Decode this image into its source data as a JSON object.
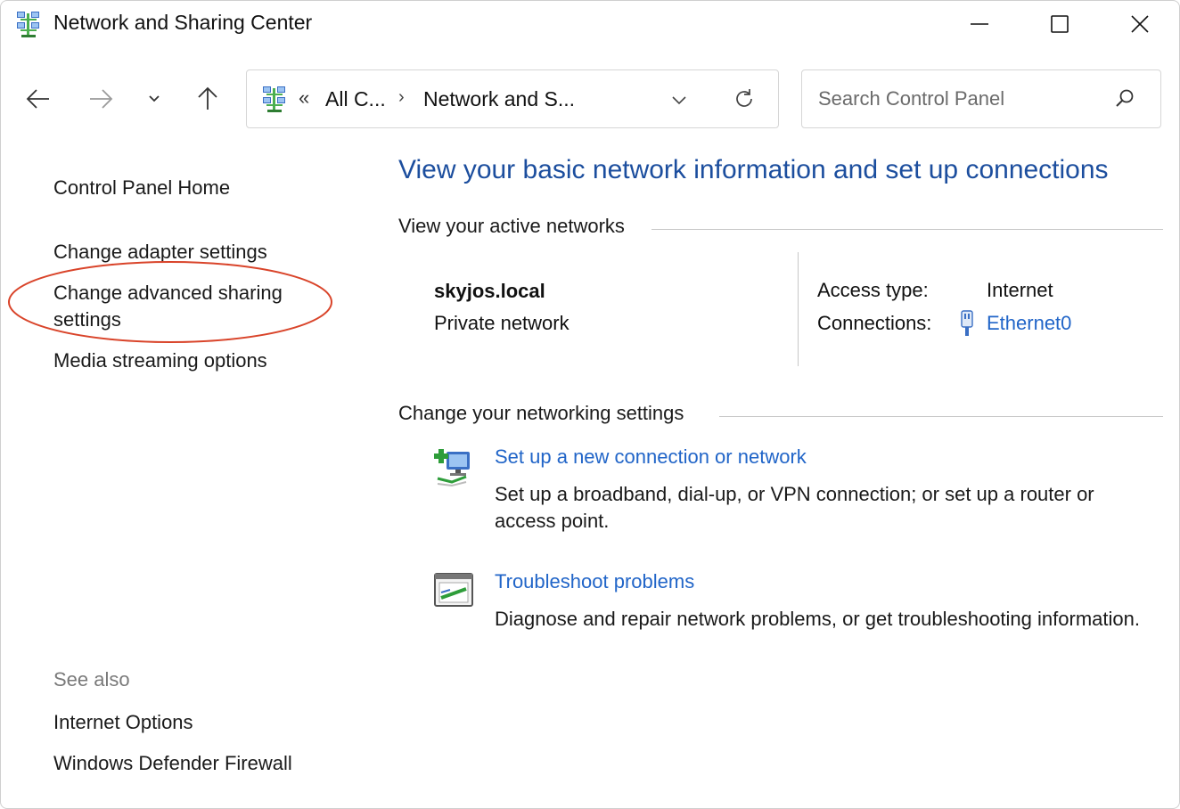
{
  "window": {
    "title": "Network and Sharing Center"
  },
  "address_bar": {
    "overflow_glyph": "«",
    "crumbs": [
      "All C...",
      "Network and S..."
    ],
    "separator": "›"
  },
  "search": {
    "placeholder": "Search Control Panel",
    "value": ""
  },
  "sidebar": {
    "home": "Control Panel Home",
    "items": [
      "Change adapter settings",
      "Change advanced sharing settings",
      "Media streaming options"
    ],
    "see_also_label": "See also",
    "see_also": [
      "Internet Options",
      "Windows Defender Firewall"
    ]
  },
  "main": {
    "heading": "View your basic network information and set up connections",
    "active_networks_title": "View your active networks",
    "network": {
      "name": "skyjos.local",
      "type": "Private network",
      "access_type_label": "Access type:",
      "access_type_value": "Internet",
      "connections_label": "Connections:",
      "connection_name": "Ethernet0"
    },
    "change_settings_title": "Change your networking settings",
    "tasks": [
      {
        "link": "Set up a new connection or network",
        "description": "Set up a broadband, dial-up, or VPN connection; or set up a router or access point."
      },
      {
        "link": "Troubleshoot problems",
        "description": "Diagnose and repair network problems, or get troubleshooting information."
      }
    ]
  },
  "colors": {
    "heading": "#1c4e9e",
    "link": "#2165c8",
    "highlight_ring": "#d9442a"
  }
}
